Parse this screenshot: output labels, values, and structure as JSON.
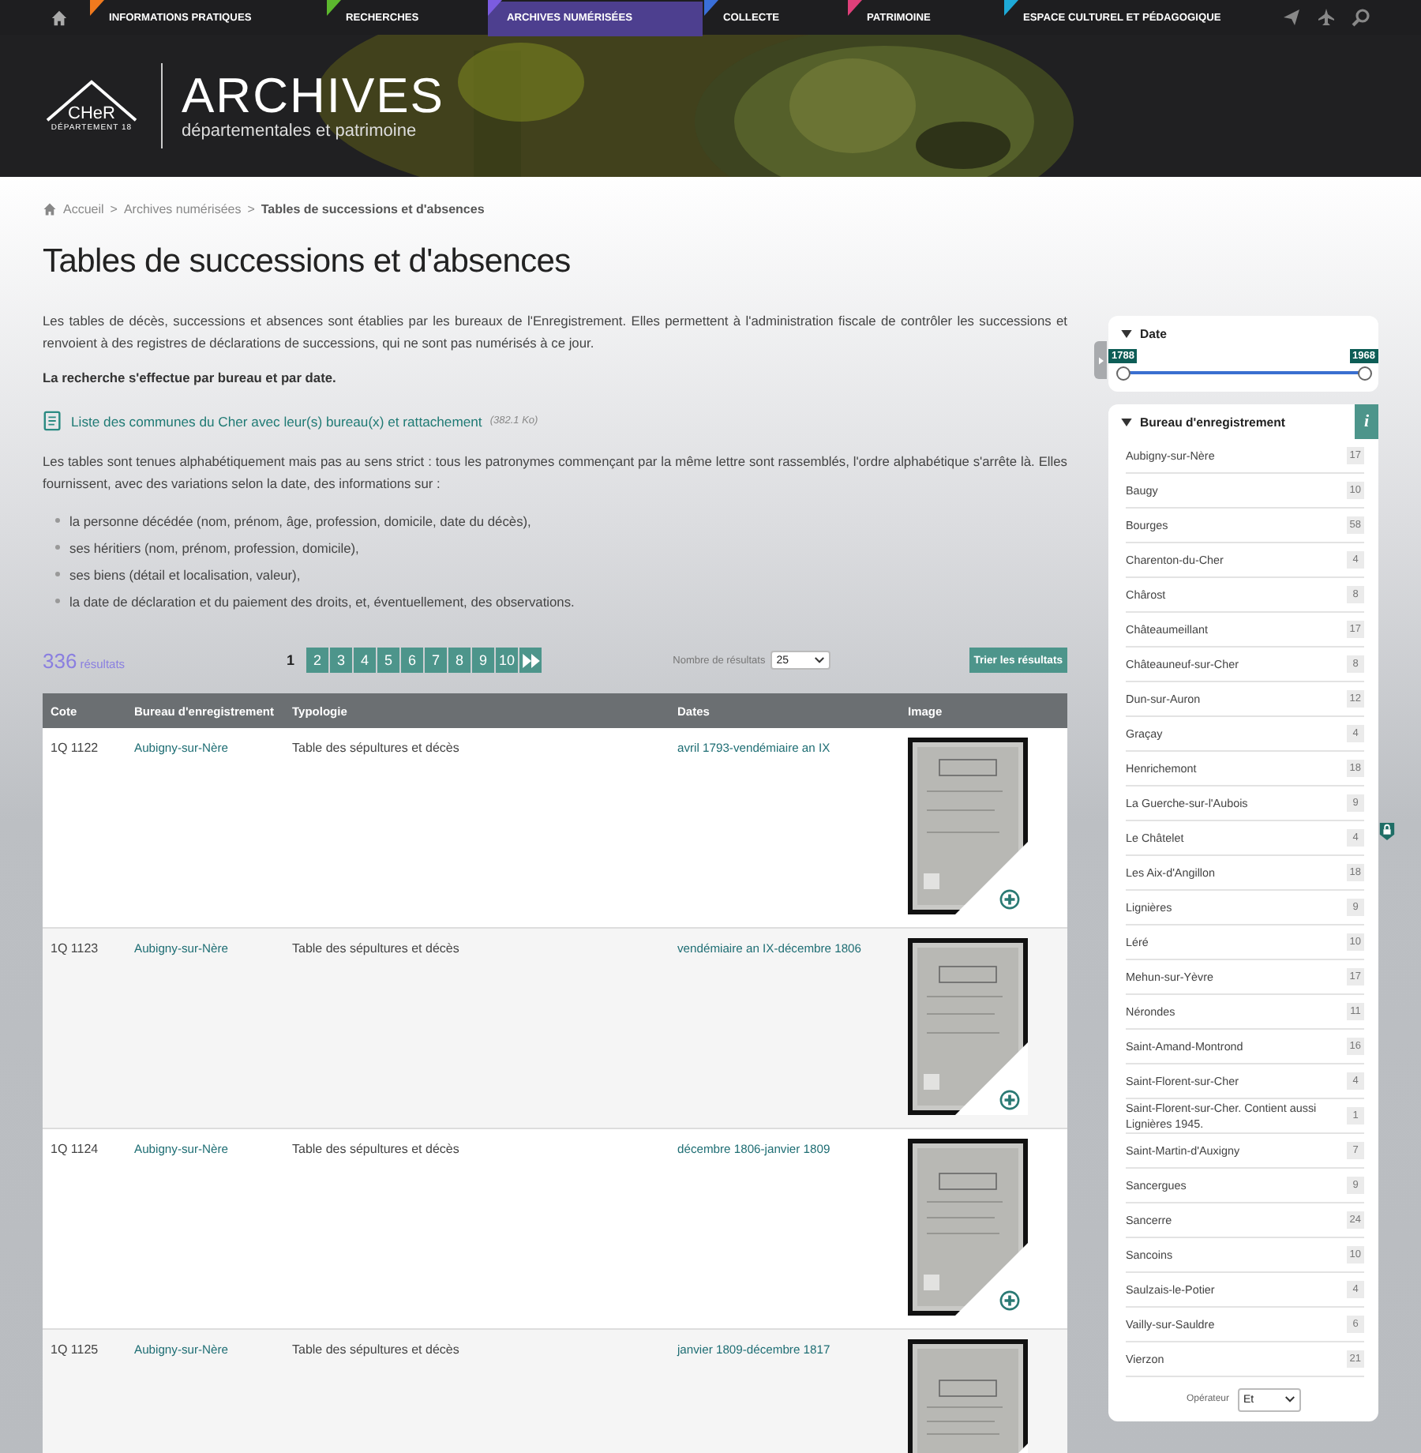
{
  "nav": {
    "items": [
      {
        "label": "INFORMATIONS PRATIQUES",
        "color": "#f07a1e",
        "selected": false
      },
      {
        "label": "RECHERCHES",
        "color": "#5cb82e",
        "selected": false
      },
      {
        "label": "ARCHIVES NUMÉRISÉES",
        "color": "#7b5ce0",
        "selected": true
      },
      {
        "label": "COLLECTE",
        "color": "#3a6fd8",
        "selected": false
      },
      {
        "label": "PATRIMOINE",
        "color": "#e0407a",
        "selected": false
      },
      {
        "label": "ESPACE CULTUREL ET PÉDAGOGIQUE",
        "color": "#1eaad8",
        "selected": false
      }
    ]
  },
  "header": {
    "logo_name": "CHeR",
    "logo_sub": "DÉPARTEMENT 18",
    "title": "ARCHIVES",
    "subtitle": "départementales et patrimoine"
  },
  "breadcrumb": [
    {
      "label": "Accueil"
    },
    {
      "separator": ">",
      "label": "Archives numérisées"
    },
    {
      "separator": ">",
      "label": "Tables de successions et d'absences"
    }
  ],
  "title": "Tables de successions et d'absences",
  "intro": "Les tables de décès, successions et absences sont établies par les bureaux de l'Enregistrement. Elles permettent à l'administration fiscale de contrôler les successions et renvoient à des registres de déclarations de successions, qui ne sont pas numérisés à ce jour.",
  "note": "La recherche s'effectue par bureau et par date.",
  "document_link": {
    "label": "Liste des communes du Cher avec leur(s) bureau(x) et rattachement",
    "size": "(382.1 Ko)"
  },
  "details": "Les tables sont tenues alphabétiquement mais pas au sens strict : tous les patronymes commençant par la même lettre sont rassemblés, l'ordre alphabétique s'arrête là. Elles fournissent, avec des variations selon la date, des informations sur :",
  "bullets": [
    "la personne décédée (nom, prénom, âge, profession, domicile, date du décès),",
    "ses héritiers (nom, prénom, profession, domicile),",
    "ses biens (détail et localisation, valeur),",
    "la date de déclaration et du paiement des droits, et, éventuellement, des observations."
  ],
  "results": {
    "count": "336",
    "label": "résultats",
    "per_page_label": "Nombre de résultats",
    "per_page": "25",
    "sort_button": "Trier les résultats"
  },
  "pages": [
    {
      "label": "1",
      "selected": true
    },
    {
      "label": "2",
      "selected": false
    },
    {
      "label": "3",
      "selected": false
    },
    {
      "label": "4",
      "selected": false
    },
    {
      "label": "5",
      "selected": false
    },
    {
      "label": "6",
      "selected": false
    },
    {
      "label": "7",
      "selected": false
    },
    {
      "label": "8",
      "selected": false
    },
    {
      "label": "9",
      "selected": false
    },
    {
      "label": "10",
      "selected": false
    }
  ],
  "table": {
    "columns": [
      "Cote",
      "Bureau d'enregistrement",
      "Typologie",
      "Dates",
      "Image"
    ],
    "rows": [
      {
        "cote": "1Q 1122",
        "bureau": "Aubigny-sur-Nère",
        "typologie": "Table des sépultures et décès",
        "dates": "avril 1793-vendémiaire an IX",
        "zoom_button": true
      },
      {
        "cote": "1Q 1123",
        "bureau": "Aubigny-sur-Nère",
        "typologie": "Table des sépultures et décès",
        "dates": "vendémiaire an IX-décembre 1806",
        "zoom_button": true
      },
      {
        "cote": "1Q 1124",
        "bureau": "Aubigny-sur-Nère",
        "typologie": "Table des sépultures et décès",
        "dates": "décembre 1806-janvier 1809",
        "zoom_button": true
      },
      {
        "cote": "1Q 1125",
        "bureau": "Aubigny-sur-Nère",
        "typologie": "Table des sépultures et décès",
        "dates": "janvier 1809-décembre 1817"
      }
    ]
  },
  "date_filter": {
    "title": "Date",
    "thumbs": [
      {
        "label": "1788",
        "level": 0
      },
      {
        "label": "1968",
        "level": 1
      }
    ]
  },
  "bureau_filter": {
    "title": "Bureau d'enregistrement",
    "info": "i",
    "operator_label": "Opérateur",
    "operator": "Et",
    "items": [
      {
        "name": "Aubigny-sur-Nère",
        "count": "17"
      },
      {
        "name": "Baugy",
        "count": "10"
      },
      {
        "name": "Bourges",
        "count": "58"
      },
      {
        "name": "Charenton-du-Cher",
        "count": "4"
      },
      {
        "name": "Chârost",
        "count": "8"
      },
      {
        "name": "Châteaumeillant",
        "count": "17"
      },
      {
        "name": "Châteauneuf-sur-Cher",
        "count": "8"
      },
      {
        "name": "Dun-sur-Auron",
        "count": "12"
      },
      {
        "name": "Graçay",
        "count": "4"
      },
      {
        "name": "Henrichemont",
        "count": "18"
      },
      {
        "name": "La Guerche-sur-l'Aubois",
        "count": "9"
      },
      {
        "name": "Le Châtelet",
        "count": "4"
      },
      {
        "name": "Les Aix-d'Angillon",
        "count": "18"
      },
      {
        "name": "Lignières",
        "count": "9"
      },
      {
        "name": "Léré",
        "count": "10"
      },
      {
        "name": "Mehun-sur-Yèvre",
        "count": "17"
      },
      {
        "name": "Nérondes",
        "count": "11"
      },
      {
        "name": "Saint-Amand-Montrond",
        "count": "16"
      },
      {
        "name": "Saint-Florent-sur-Cher",
        "count": "4"
      },
      {
        "name": "Saint-Florent-sur-Cher. Contient aussi Lignières 1945.",
        "count": "1"
      },
      {
        "name": "Saint-Martin-d'Auxigny",
        "count": "7"
      },
      {
        "name": "Sancergues",
        "count": "9"
      },
      {
        "name": "Sancerre",
        "count": "24"
      },
      {
        "name": "Sancoins",
        "count": "10"
      },
      {
        "name": "Saulzais-le-Potier",
        "count": "4"
      },
      {
        "name": "Vailly-sur-Sauldre",
        "count": "6"
      },
      {
        "name": "Vierzon",
        "count": "21"
      }
    ]
  }
}
